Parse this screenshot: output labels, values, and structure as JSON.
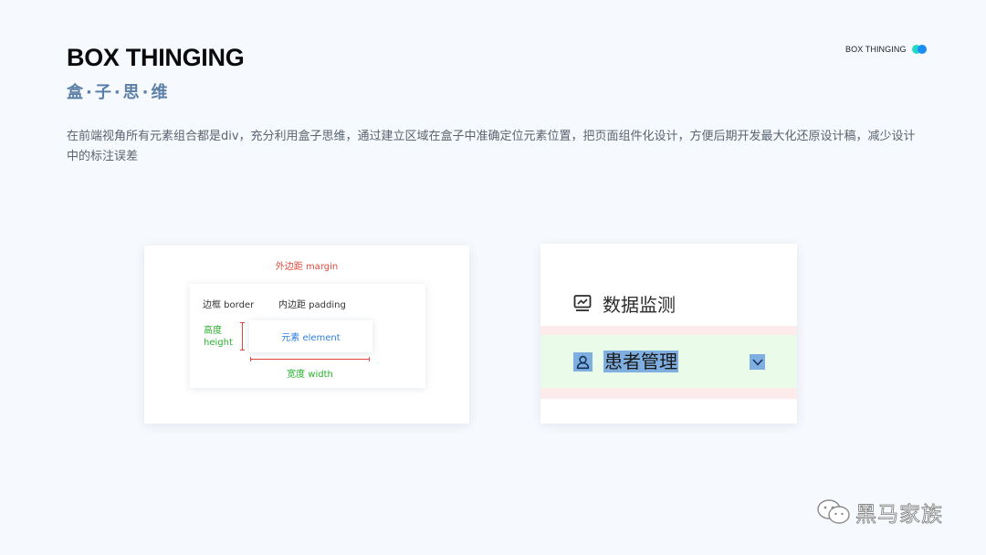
{
  "header": {
    "title": "BOX THINGING",
    "subtitle": "盒·子·思·维",
    "brand_label": "BOX THINGING",
    "brand_colors": [
      "#21d8c6",
      "#1e8cf5"
    ]
  },
  "description": "在前端视角所有元素组合都是div，充分利用盒子思维，通过建立区域在盒子中准确定位元素位置，把页面组件化设计，方便后期开发最大化还原设计稿，减少设计中的标注误差",
  "box_model": {
    "margin_label": "外边距 margin",
    "border_label": "边框 border",
    "padding_label": "内边距 padding",
    "height_label_cn": "高度",
    "height_label_en": "height",
    "element_label": "元素 element",
    "width_label": "宽度 width",
    "colors": {
      "margin": "#e0483c",
      "dimension": "#27b22c",
      "element": "#2d7fe0"
    }
  },
  "menu": {
    "items": [
      {
        "label": "数据监测",
        "icon": "monitor-chart-icon"
      },
      {
        "label": "患者管理",
        "icon": "user-icon",
        "selected": true,
        "trailing_icon": "chevron-down-icon"
      }
    ],
    "colors": {
      "margin_highlight": "#fdebec",
      "padding_highlight": "#eafbea",
      "selection": "#7faee0"
    }
  },
  "watermark": {
    "icon": "wechat-icon",
    "label": "黑马家族"
  }
}
